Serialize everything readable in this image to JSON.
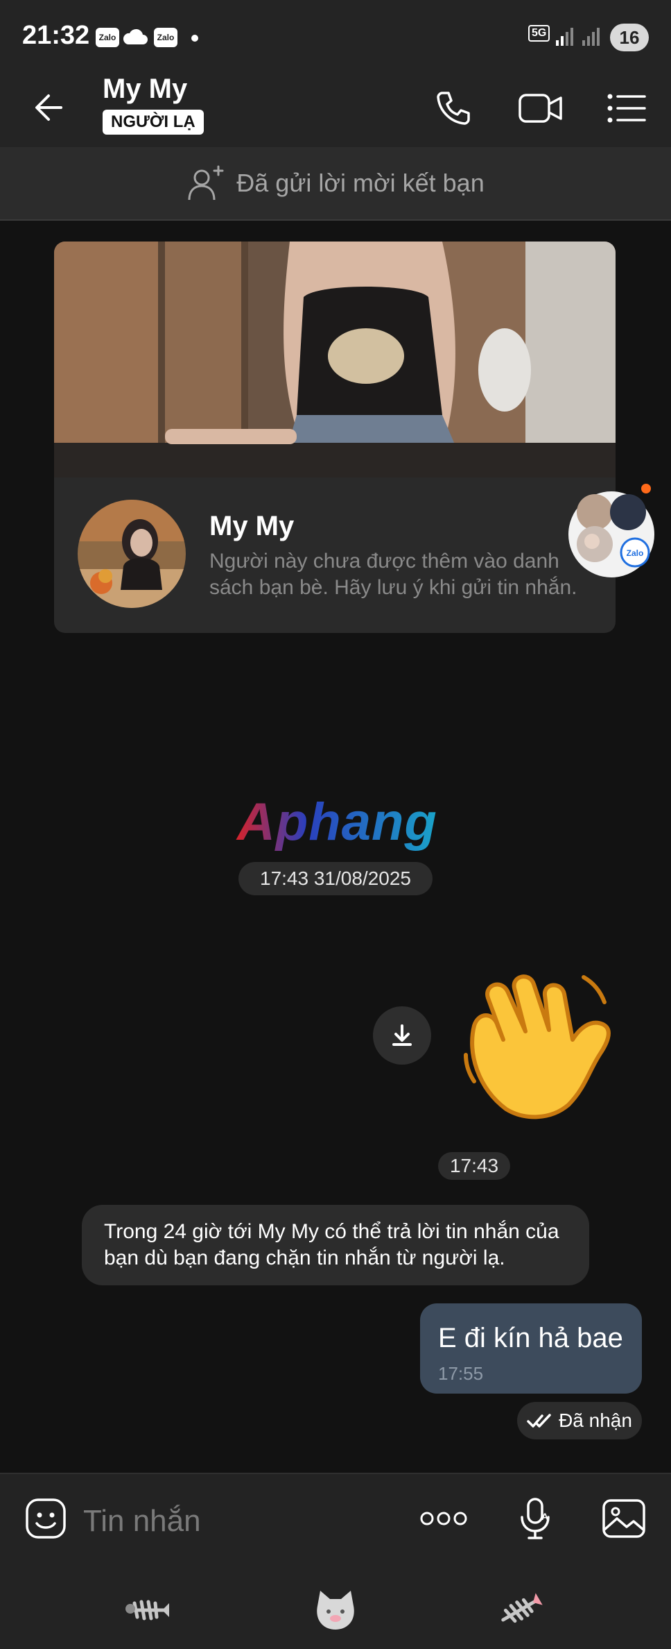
{
  "status_bar": {
    "time": "21:32",
    "badge_app_1": "Zalo",
    "badge_app_2": "Zalo",
    "network": "5G",
    "battery": "16"
  },
  "header": {
    "contact_name": "My My",
    "badge": "NGƯỜI LẠ"
  },
  "friend_request": {
    "label": "Đã gửi lời mời kết bạn"
  },
  "profile_card": {
    "name": "My My",
    "note": "Người này chưa được thêm vào danh sách bạn bè. Hãy lưu ý khi gửi tin nhắn."
  },
  "watermark": "Aphang",
  "messages": {
    "date_separator": "17:43 31/08/2025",
    "sticker_time": "17:43",
    "system_notice": "Trong 24 giờ tới My My có thể trả lời tin nhắn của bạn dù bạn đang chặn tin nhắn từ người lạ.",
    "outgoing_text": "E đi kín hả bae",
    "outgoing_time": "17:55",
    "delivery_status": "Đã nhận"
  },
  "composer": {
    "placeholder": "Tin nhắn"
  },
  "colors": {
    "background": "#121212",
    "bar": "#242424",
    "outgoing_bubble": "#3d4b5c",
    "pill": "#2c2c2c",
    "notification_dot": "#ff6a1a"
  }
}
